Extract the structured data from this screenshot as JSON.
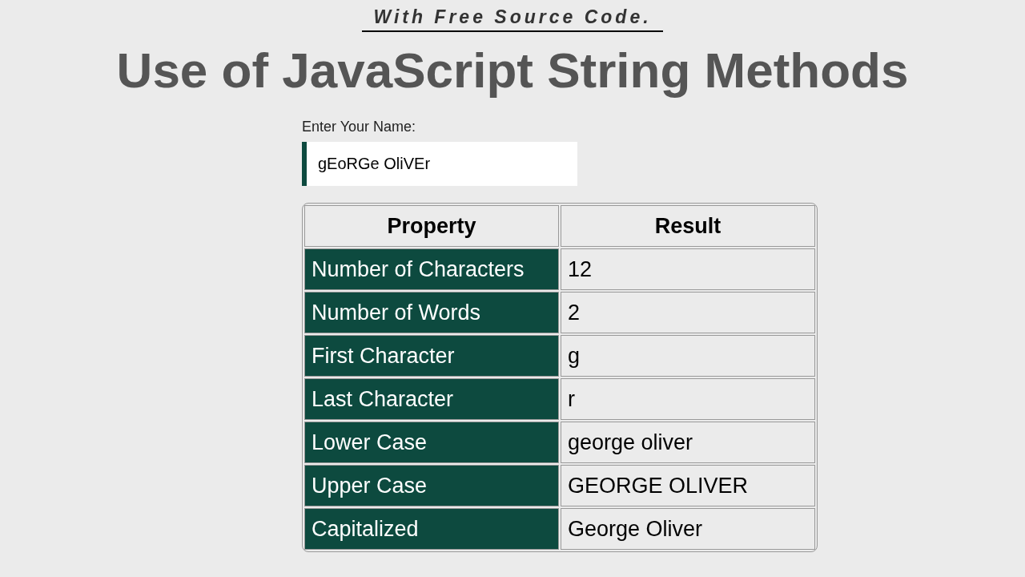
{
  "tagline": "With Free Source Code.",
  "title": "Use of JavaScript String Methods",
  "name_field": {
    "label": "Enter Your Name:",
    "value": "gEoRGe OliVEr"
  },
  "table": {
    "columns": [
      "Property",
      "Result"
    ],
    "rows": [
      {
        "property": "Number of Characters",
        "result": "12"
      },
      {
        "property": "Number of Words",
        "result": "2"
      },
      {
        "property": "First Character",
        "result": "g"
      },
      {
        "property": "Last Character",
        "result": "r"
      },
      {
        "property": "Lower Case",
        "result": "george oliver"
      },
      {
        "property": "Upper Case",
        "result": "GEORGE OLIVER"
      },
      {
        "property": "Capitalized",
        "result": "George Oliver"
      }
    ]
  }
}
